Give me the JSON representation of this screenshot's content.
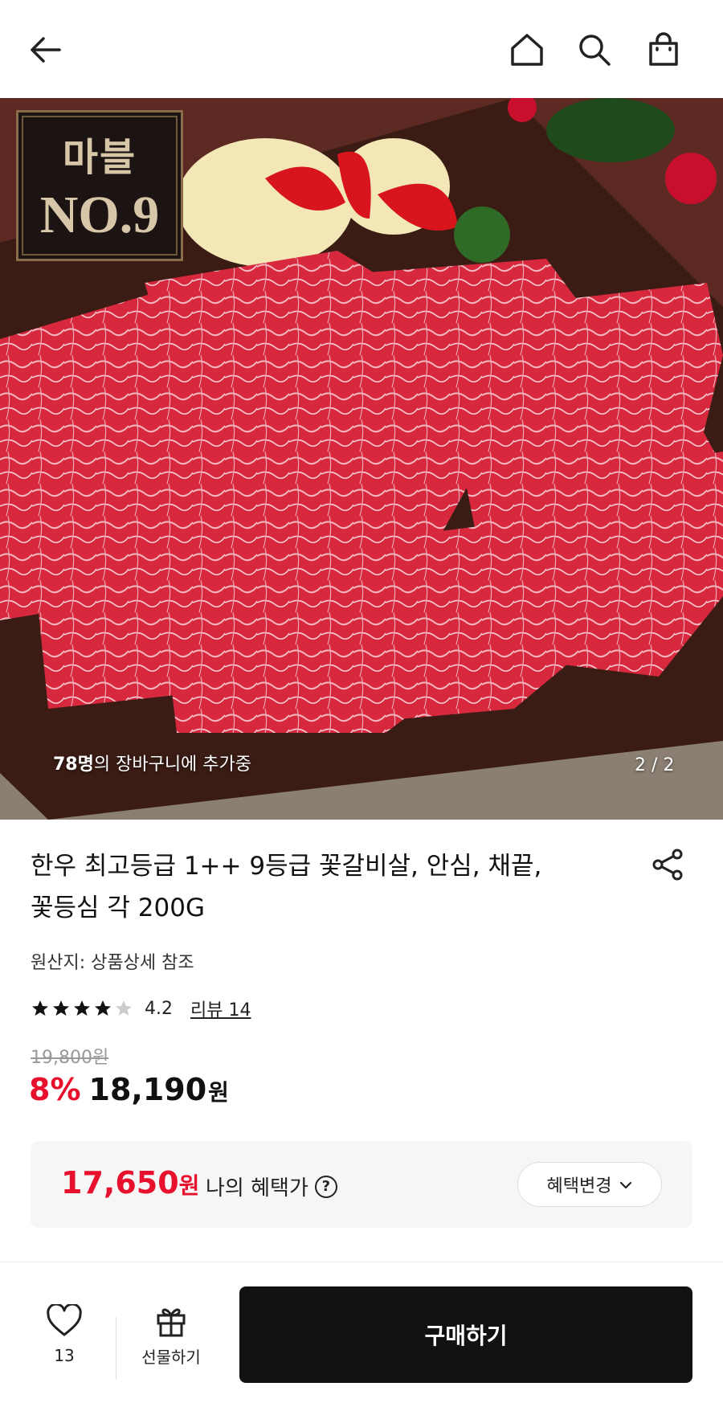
{
  "header": {
    "back_icon": "arrow-left-icon",
    "home_icon": "home-icon",
    "search_icon": "search-icon",
    "cart_icon": "shopping-bag-icon"
  },
  "hero": {
    "badge_line1": "마블",
    "badge_line2": "NO.9",
    "cart_count_number": "78명",
    "cart_count_text": "의 장바구니에 추가중",
    "image_index": "2 / 2"
  },
  "product": {
    "title_line1": "한우 최고등급 1++ 9등급 꽃갈비살, 안심, 채끝,",
    "title_line2": "꽃등심 각 200G",
    "origin": "원산지: 상품상세 참조",
    "rating_value": "4.2",
    "rating_stars": 4.2,
    "review_link": "리뷰 14",
    "original_price": "19,800원",
    "discount": "8%",
    "price": "18,190",
    "currency": "원"
  },
  "benefit": {
    "price": "17,650",
    "currency": "원",
    "label": "나의 혜택가",
    "help_icon": "?",
    "change_button": "혜택변경",
    "change_chevron": "⌄"
  },
  "bottom_bar": {
    "like_count": "13",
    "gift_label": "선물하기",
    "buy_label": "구매하기"
  },
  "colors": {
    "accent_red": "#e8112d",
    "buy_button_bg": "#111111",
    "benefit_bg": "#f6f6f6"
  }
}
